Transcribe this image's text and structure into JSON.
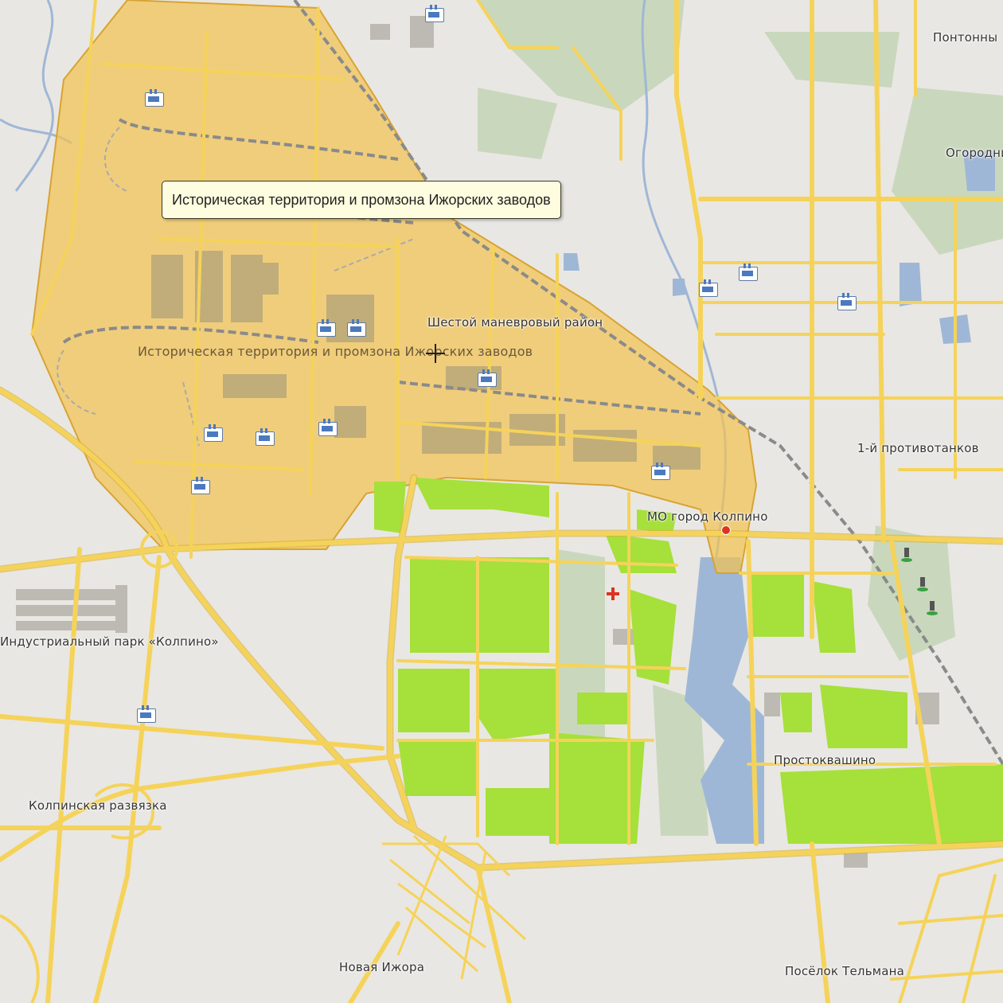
{
  "map": {
    "tooltip": "Историческая территория и промзона Ижорских заводов",
    "labels": {
      "pontonny": "Понтонны",
      "ogorodniki": "Огородни",
      "shestoy": "Шестой маневровый район",
      "zone": "Историческая территория и промзона Ижорских заводов",
      "protivotank": "1-й противотанков",
      "kolpino_mo": "МО город Колпино",
      "industrial_park": "Индустриальный парк «Колпино»",
      "kolpinskaya": "Колпинская развязка",
      "prostokvashino": "Простоквашино",
      "novaya_izhora": "Новая Ижора",
      "telmana": "Посёлок Тельмана"
    },
    "colors": {
      "background": "#e9e7e3",
      "road": "#f5d35a",
      "road_edge": "#d9b23a",
      "water": "#9fb7d6",
      "park": "#c9d8bd",
      "greenery": "#a6e03a",
      "zone_fill": "#f2c24f",
      "zone_edge": "#d7a432",
      "building": "#bdbab3",
      "rail": "#8a8a8a"
    },
    "icons": [
      "factory-icon",
      "monument-icon",
      "hospital-cross-icon",
      "red-pin-icon",
      "crosshair-cursor-icon"
    ]
  }
}
